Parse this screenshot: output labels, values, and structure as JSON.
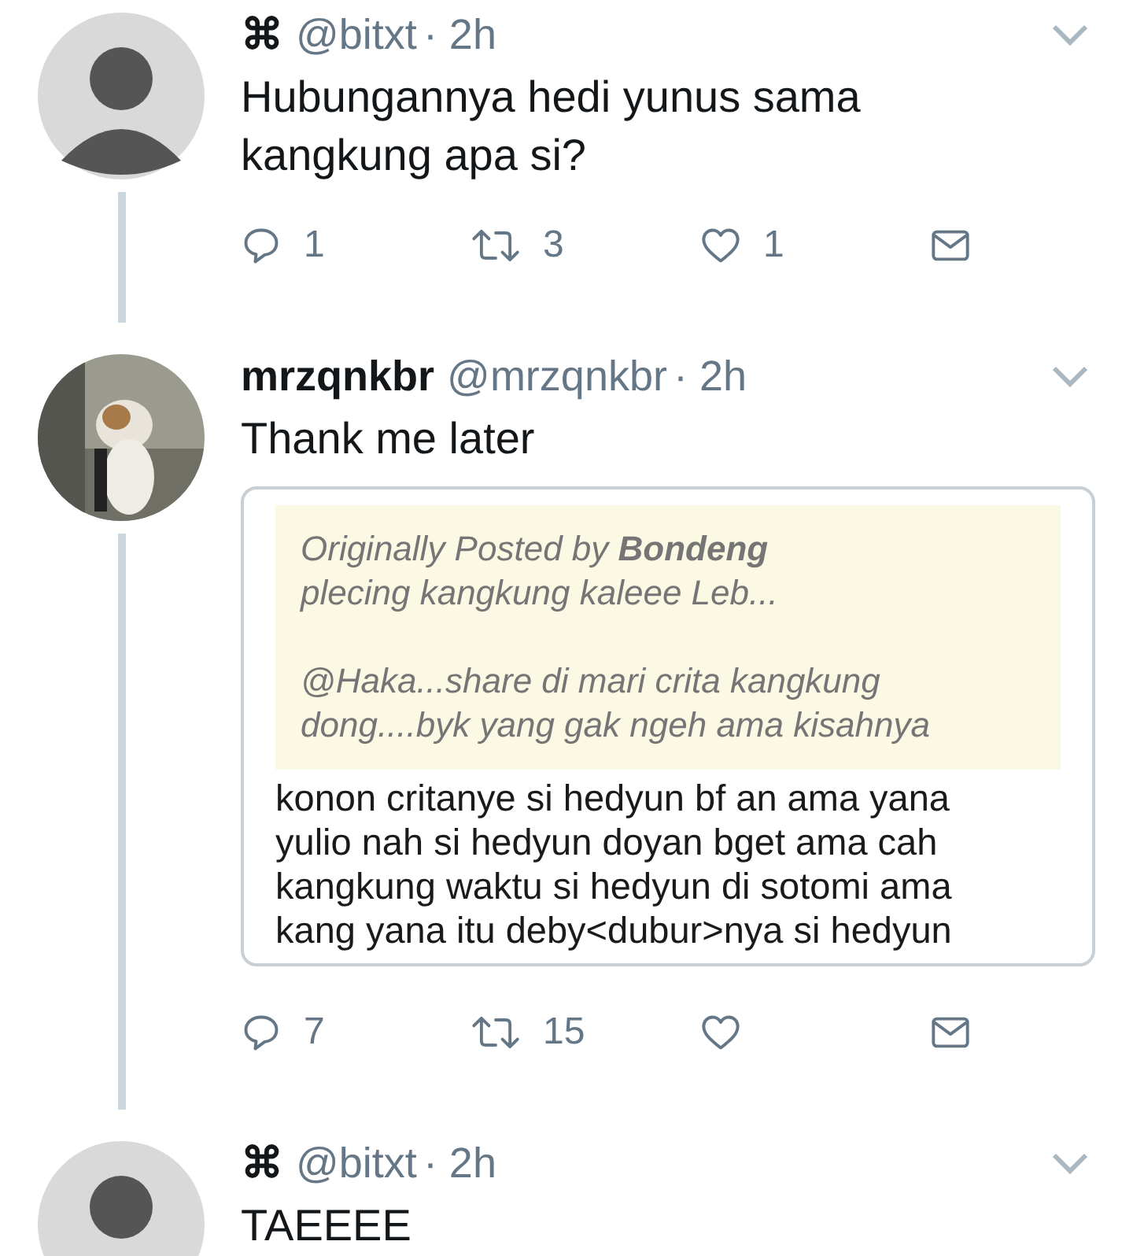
{
  "tweets": [
    {
      "avatar": {
        "kind": "silhouette"
      },
      "name": "⌘",
      "handle": "@bitxt",
      "time": "· 2h",
      "text_lines": [
        "Hubungannya hedi yunus sama",
        "kangkung apa si?"
      ],
      "actions": {
        "replies": "1",
        "retweets": "3",
        "likes": "1"
      }
    },
    {
      "avatar": {
        "kind": "picture"
      },
      "name": "mrzqnkbr",
      "handle": "@mrzqnkbr",
      "time": "· 2h",
      "text_lines": [
        "Thank me later"
      ],
      "forum_post": {
        "quote_lines": [
          "Originally Posted by **Bondeng**",
          "plecing kangkung kaleee Leb..."
        ],
        "quote_lines_2": [
          "@Haka...share di mari crita kangkung",
          "dong....byk yang gak ngeh ama kisahnya"
        ],
        "body_lines": [
          "konon critanye si hedyun bf an ama yana",
          "yulio nah si hedyun doyan bget ama cah",
          "kangkung waktu si hedyun di sotomi ama",
          "kang yana itu deby<dubur>nya si hedyun"
        ]
      },
      "actions": {
        "replies": "7",
        "retweets": "15"
      }
    },
    {
      "avatar": {
        "kind": "silhouette"
      },
      "name": "⌘",
      "handle": "@bitxt",
      "time": "· 2h",
      "text_lines": [
        "TAEEEE"
      ]
    }
  ]
}
